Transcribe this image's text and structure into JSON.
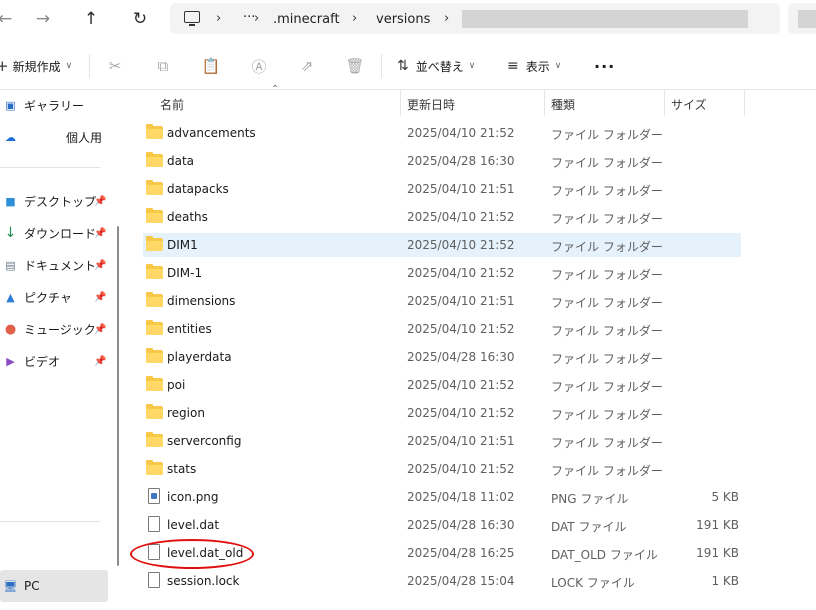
{
  "address": {
    "crumbs": [
      ".minecraft",
      "versions"
    ],
    "ellipsis": "···",
    "sep": "›"
  },
  "toolbar": {
    "new_label": "新規作成",
    "sort_label": "並べ替え",
    "view_label": "表示",
    "more_label": "···"
  },
  "sidebar": {
    "items": [
      {
        "label": "ギャラリー",
        "icon": "gallery-icon"
      },
      {
        "label": "個人用",
        "icon": "onedrive-icon"
      },
      {
        "label": "デスクトップ",
        "icon": "desktop-icon"
      },
      {
        "label": "ダウンロード",
        "icon": "download-icon"
      },
      {
        "label": "ドキュメント",
        "icon": "documents-icon"
      },
      {
        "label": "ピクチャ",
        "icon": "pictures-icon"
      },
      {
        "label": "ミュージック",
        "icon": "music-icon"
      },
      {
        "label": "ビデオ",
        "icon": "video-icon"
      },
      {
        "label": "PC",
        "icon": "pc-icon"
      }
    ]
  },
  "columns": {
    "name": "名前",
    "date": "更新日時",
    "type": "種類",
    "size": "サイズ"
  },
  "files": [
    {
      "name": "advancements",
      "date": "2025/04/10 21:52",
      "type": "ファイル フォルダー",
      "size": "",
      "kind": "folder"
    },
    {
      "name": "data",
      "date": "2025/04/28 16:30",
      "type": "ファイル フォルダー",
      "size": "",
      "kind": "folder"
    },
    {
      "name": "datapacks",
      "date": "2025/04/10 21:51",
      "type": "ファイル フォルダー",
      "size": "",
      "kind": "folder"
    },
    {
      "name": "deaths",
      "date": "2025/04/10 21:52",
      "type": "ファイル フォルダー",
      "size": "",
      "kind": "folder"
    },
    {
      "name": "DIM1",
      "date": "2025/04/10 21:52",
      "type": "ファイル フォルダー",
      "size": "",
      "kind": "folder"
    },
    {
      "name": "DIM-1",
      "date": "2025/04/10 21:52",
      "type": "ファイル フォルダー",
      "size": "",
      "kind": "folder"
    },
    {
      "name": "dimensions",
      "date": "2025/04/10 21:51",
      "type": "ファイル フォルダー",
      "size": "",
      "kind": "folder"
    },
    {
      "name": "entities",
      "date": "2025/04/10 21:52",
      "type": "ファイル フォルダー",
      "size": "",
      "kind": "folder"
    },
    {
      "name": "playerdata",
      "date": "2025/04/28 16:30",
      "type": "ファイル フォルダー",
      "size": "",
      "kind": "folder"
    },
    {
      "name": "poi",
      "date": "2025/04/10 21:52",
      "type": "ファイル フォルダー",
      "size": "",
      "kind": "folder"
    },
    {
      "name": "region",
      "date": "2025/04/10 21:52",
      "type": "ファイル フォルダー",
      "size": "",
      "kind": "folder"
    },
    {
      "name": "serverconfig",
      "date": "2025/04/10 21:51",
      "type": "ファイル フォルダー",
      "size": "",
      "kind": "folder"
    },
    {
      "name": "stats",
      "date": "2025/04/10 21:52",
      "type": "ファイル フォルダー",
      "size": "",
      "kind": "folder"
    },
    {
      "name": "icon.png",
      "date": "2025/04/18 11:02",
      "type": "PNG ファイル",
      "size": "5 KB",
      "kind": "png"
    },
    {
      "name": "level.dat",
      "date": "2025/04/28 16:30",
      "type": "DAT ファイル",
      "size": "191 KB",
      "kind": "file"
    },
    {
      "name": "level.dat_old",
      "date": "2025/04/28 16:25",
      "type": "DAT_OLD ファイル",
      "size": "191 KB",
      "kind": "file"
    },
    {
      "name": "session.lock",
      "date": "2025/04/28 15:04",
      "type": "LOCK ファイル",
      "size": "1 KB",
      "kind": "file"
    }
  ],
  "hover_row": "DIM1",
  "highlight": {
    "color": "#e01010",
    "target": "level.dat_old"
  }
}
